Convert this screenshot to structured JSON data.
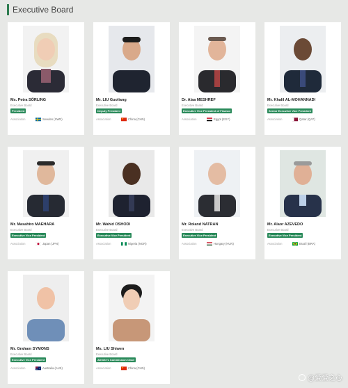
{
  "header": {
    "title": "Executive Board"
  },
  "members": [
    {
      "name": "Ms. Petra SÖRLING",
      "subtitle": "Executive Board",
      "role": "President",
      "association_label": "Association",
      "country": "Sweden (SWE)",
      "flag": "sweden"
    },
    {
      "name": "Mr. LIU Guoliang",
      "subtitle": "Executive Board",
      "role": "Deputy President",
      "association_label": "Association",
      "country": "China (CHN)",
      "flag": "china"
    },
    {
      "name": "Dr. Alaa MESHREF",
      "subtitle": "Executive Board",
      "role": "Executive Vice President of Finance",
      "association_label": "Association",
      "country": "Egypt (EGY)",
      "flag": "egypt"
    },
    {
      "name": "Mr. Khalil AL-MOHANNADI",
      "subtitle": "Executive Board",
      "role": "Senior Executive Vice President",
      "association_label": "Association",
      "country": "Qatar (QAT)",
      "flag": "qatar"
    },
    {
      "name": "Mr. Masahiro MAEHARA",
      "subtitle": "Executive Board",
      "role": "Executive Vice President",
      "association_label": "Association",
      "country": "Japan (JPN)",
      "flag": "japan"
    },
    {
      "name": "Mr. Wahid OSHODI",
      "subtitle": "Executive Board",
      "role": "Executive Vice President",
      "association_label": "Association",
      "country": "Nigeria (NGR)",
      "flag": "nigeria"
    },
    {
      "name": "Mr. Roland NATRAN",
      "subtitle": "Executive Board",
      "role": "Executive Vice President",
      "association_label": "Association",
      "country": "Hungary (HUN)",
      "flag": "hungary"
    },
    {
      "name": "Mr. Alaor AZEVEDO",
      "subtitle": "Executive Board",
      "role": "Executive Vice President",
      "association_label": "Association",
      "country": "Brazil (BRA)",
      "flag": "brazil"
    },
    {
      "name": "Mr. Graham SYMONS",
      "subtitle": "Executive Board",
      "role": "Executive Vice President",
      "association_label": "Association",
      "country": "Australia (AUS)",
      "flag": "australia"
    },
    {
      "name": "Ms. LIU Shiwen",
      "subtitle": "Executive Board",
      "role": "Athlete's Commission Chair",
      "association_label": "Association",
      "country": "China (CHN)",
      "flag": "china"
    }
  ],
  "watermark": {
    "text": "@爱爱之心"
  },
  "colors": {
    "accent": "#2a8a5a",
    "background": "#e7e8e6"
  }
}
